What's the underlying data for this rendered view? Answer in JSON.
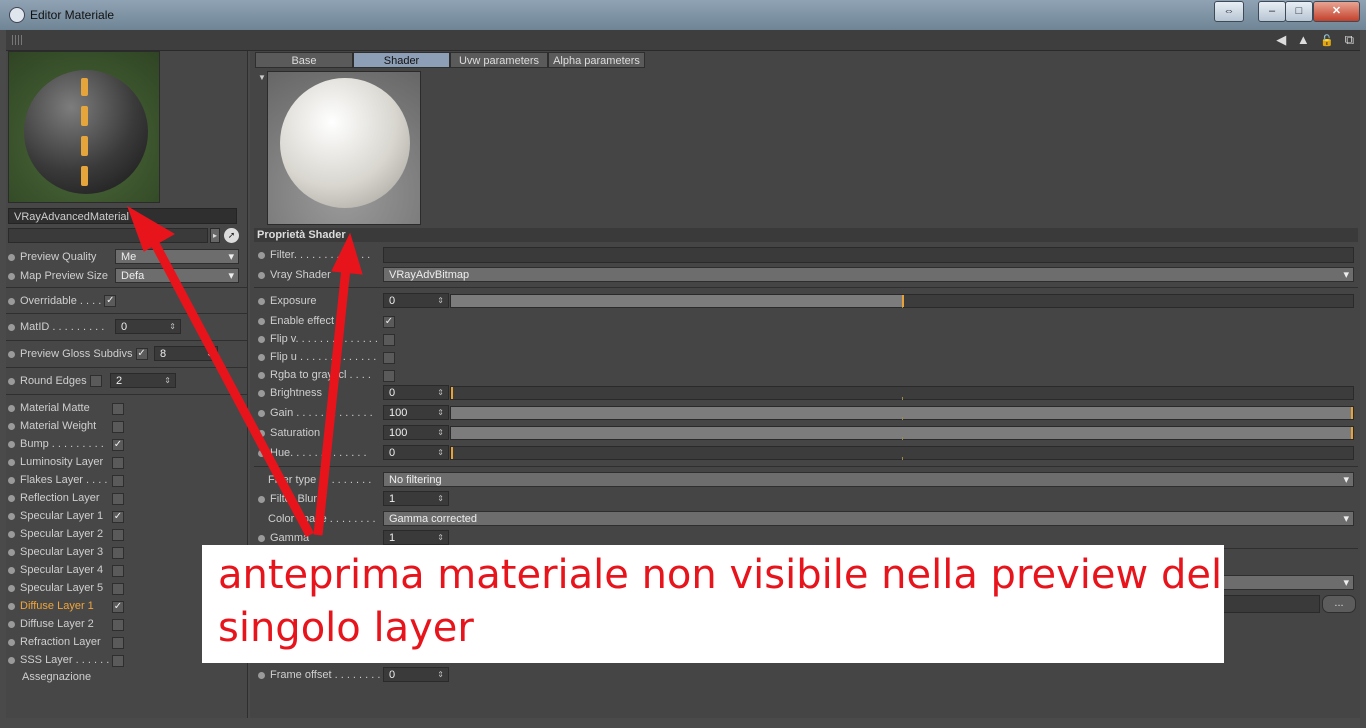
{
  "window": {
    "title": "Editor Materiale",
    "restore_label": "⇔",
    "minimize_label": "–",
    "maximize_label": "□",
    "close_label": "✕"
  },
  "toolbar": {
    "icons": [
      "arrow-left-icon",
      "arrow-up-icon",
      "lock-icon",
      "new-window-icon"
    ],
    "glyphs": [
      "◀",
      "▲",
      "🔓",
      "⧉"
    ]
  },
  "left": {
    "material_name": "VRayAdvancedMaterial",
    "preview_quality": {
      "label": "Preview Quality",
      "value": "Me"
    },
    "map_preview_size": {
      "label": "Map Preview Size",
      "value": "Defa"
    },
    "overridable": {
      "label": "Overridable . . . .",
      "checked": "✓"
    },
    "matid": {
      "label": "MatID . . . . . . . . .",
      "value": "0"
    },
    "preview_gloss": {
      "label": "Preview Gloss Subdivs",
      "checked": "✓",
      "value": "8"
    },
    "round_edges": {
      "label": "Round Edges",
      "value": "2"
    },
    "layers": [
      {
        "label": "Material Matte",
        "checked": ""
      },
      {
        "label": "Material Weight",
        "checked": ""
      },
      {
        "label": "Bump . . . . . . . . .",
        "checked": "✓"
      },
      {
        "label": "Luminosity Layer",
        "checked": ""
      },
      {
        "label": "Flakes Layer . . . .",
        "checked": ""
      },
      {
        "label": "Reflection Layer",
        "checked": ""
      },
      {
        "label": "Specular Layer 1",
        "checked": "✓"
      },
      {
        "label": "Specular Layer 2",
        "checked": ""
      },
      {
        "label": "Specular Layer 3",
        "checked": ""
      },
      {
        "label": "Specular Layer 4",
        "checked": ""
      },
      {
        "label": "Specular Layer 5",
        "checked": ""
      },
      {
        "label": "Diffuse Layer 1",
        "checked": "✓"
      },
      {
        "label": "Diffuse Layer 2",
        "checked": ""
      },
      {
        "label": "Refraction Layer",
        "checked": ""
      },
      {
        "label": "SSS Layer . . . . . .",
        "checked": ""
      }
    ],
    "assignment": "Assegnazione"
  },
  "tabs": [
    {
      "label": "Base"
    },
    {
      "label": "Shader"
    },
    {
      "label": "Uvw parameters"
    },
    {
      "label": "Alpha parameters"
    }
  ],
  "shader": {
    "section_title": "Proprietà Shader",
    "filter": "Filter. . . . . . . . . . . . .",
    "vray_shader": {
      "label": "Vray Shader",
      "value": "VRayAdvBitmap"
    },
    "exposure": {
      "label": "Exposure",
      "value": "0",
      "fill": 0.5
    },
    "enable_effect": {
      "label": "Enable effect",
      "checked": "✓"
    },
    "flip_v": {
      "label": "Flip v. . . . . . . . . . . . . .",
      "checked": ""
    },
    "flip_u": {
      "label": "Flip u . . . . . . . . . . . . .",
      "checked": ""
    },
    "rgba_to_gray": {
      "label": "Rgba to grayscl . . . .",
      "checked": ""
    },
    "brightness": {
      "label": "Brightness",
      "value": "0",
      "fill": 0
    },
    "gain": {
      "label": "Gain . . . . . . . . . . . . .",
      "value": "100",
      "fill": 1
    },
    "saturation": {
      "label": "Saturation",
      "value": "100",
      "fill": 1
    },
    "hue": {
      "label": "Hue. . . . . . . . . . . . .",
      "value": "0",
      "fill": 0
    },
    "filter_type": {
      "label": "Filter type . . . . . . . . .",
      "value": "No filtering"
    },
    "filter_blur": {
      "label": "Filter Blur",
      "value": "1"
    },
    "color_space": {
      "label": "Color space . . . . . . . .",
      "value": "Gamma corrected"
    },
    "gamma": {
      "label": "Gamma",
      "value": "1"
    },
    "frame_offset": {
      "label": "Frame offset . . . . . . . .",
      "value": "0"
    },
    "more_button": "..."
  },
  "annotation": {
    "line1": "anteprima materiale non visibile nella preview del",
    "line2": "singolo layer",
    "color": "#e8141c"
  },
  "colors": {
    "accent_knob": "#e8a23a",
    "active_tab": "#8d9fb6",
    "highlight_layer": "#f0a53a"
  }
}
